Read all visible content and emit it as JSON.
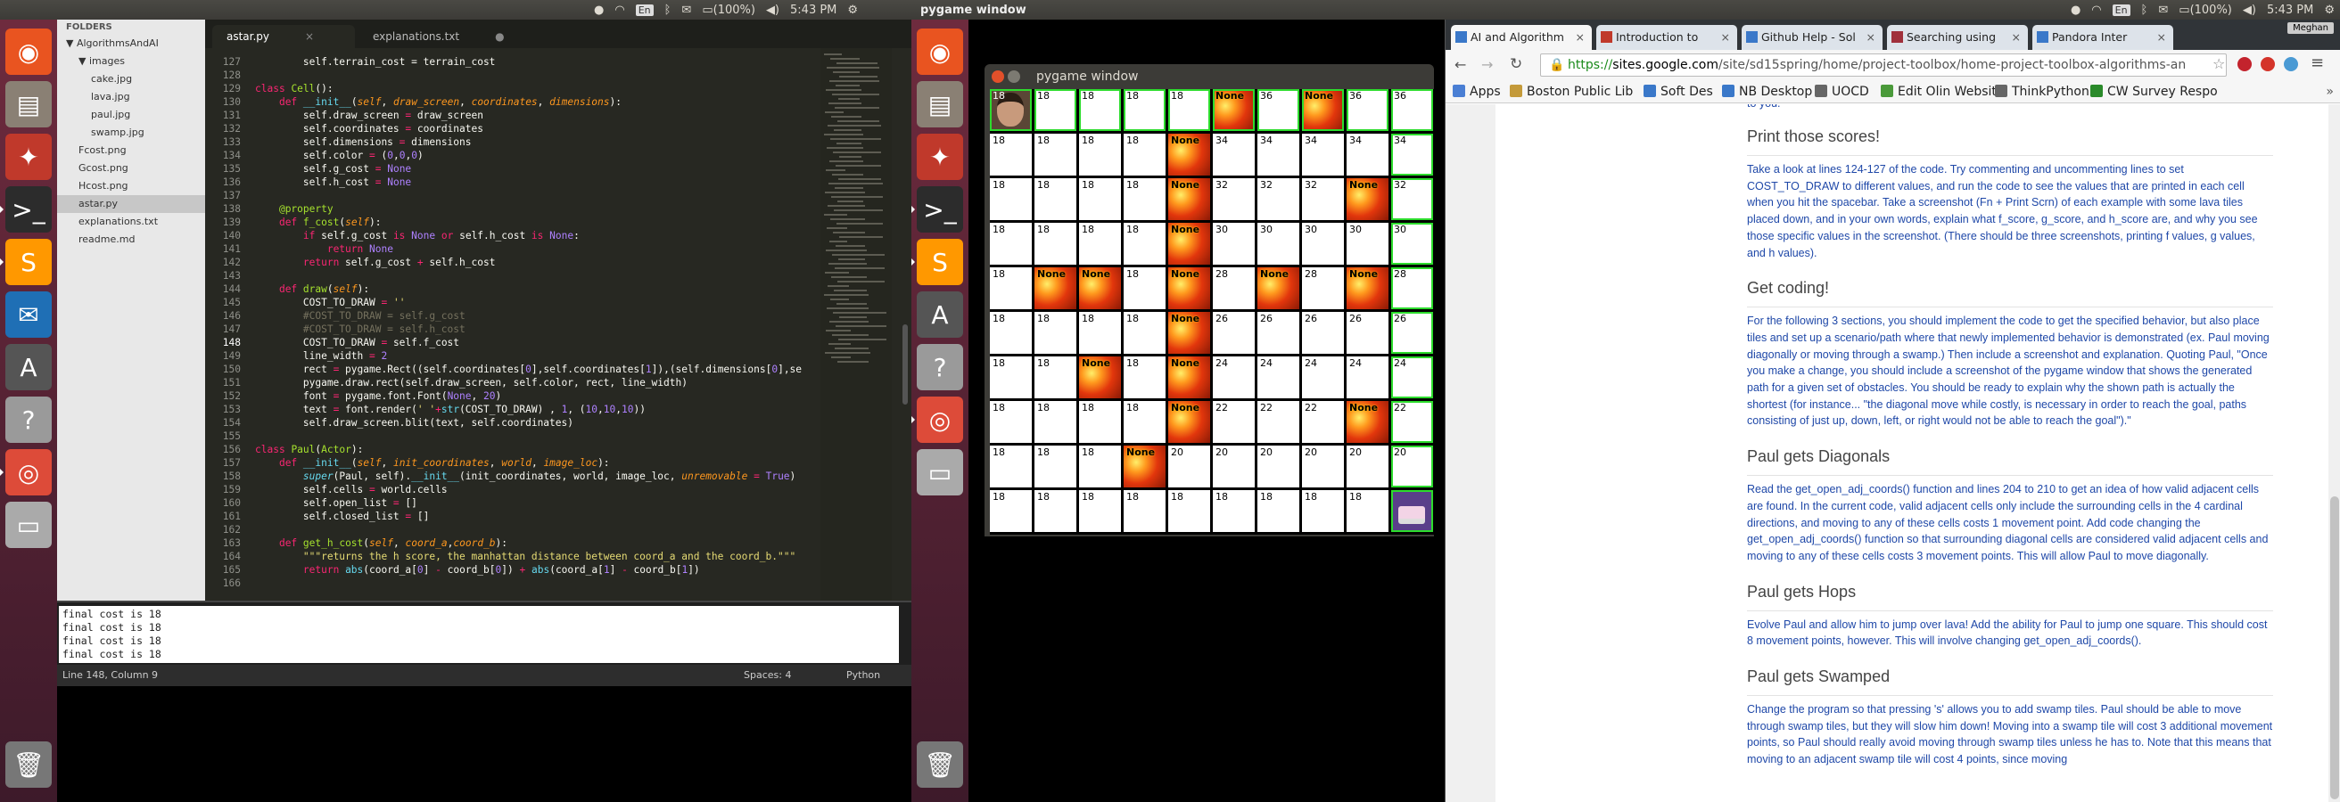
{
  "topbar_left": {
    "lang": "En",
    "battery": "(100%)",
    "time": "5:43 PM",
    "window_title": "pygame window"
  },
  "topbar_right": {
    "lang": "En",
    "battery": "(100%)",
    "time": "5:43 PM"
  },
  "chrome_user": "Meghan",
  "sidebar": {
    "header": "FOLDERS",
    "items": [
      {
        "label": "AlgorithmsAndAI",
        "indent": 0,
        "arrow": "▼"
      },
      {
        "label": "images",
        "indent": 1,
        "arrow": "▼"
      },
      {
        "label": "cake.jpg",
        "indent": 2,
        "arrow": ""
      },
      {
        "label": "lava.jpg",
        "indent": 2,
        "arrow": ""
      },
      {
        "label": "paul.jpg",
        "indent": 2,
        "arrow": ""
      },
      {
        "label": "swamp.jpg",
        "indent": 2,
        "arrow": ""
      },
      {
        "label": "Fcost.png",
        "indent": 1,
        "arrow": ""
      },
      {
        "label": "Gcost.png",
        "indent": 1,
        "arrow": ""
      },
      {
        "label": "Hcost.png",
        "indent": 1,
        "arrow": ""
      },
      {
        "label": "astar.py",
        "indent": 1,
        "arrow": "",
        "selected": true
      },
      {
        "label": "explanations.txt",
        "indent": 1,
        "arrow": ""
      },
      {
        "label": "readme.md",
        "indent": 1,
        "arrow": ""
      }
    ]
  },
  "editor_tabs": [
    {
      "label": "astar.py",
      "close": "×",
      "active": true
    },
    {
      "label": "explanations.txt",
      "close": "●",
      "active": false
    }
  ],
  "code_lines": [
    {
      "n": "127",
      "html": "        self.terrain_cost = terrain_cost"
    },
    {
      "n": "128",
      "html": ""
    },
    {
      "n": "129",
      "html": "<span class='k'>class</span> <span class='f'>Cell</span>():"
    },
    {
      "n": "130",
      "html": "    <span class='k'>def</span> <span class='bl'>__init__</span>(<span class='p'>self</span>, <span class='p'>draw_screen</span>, <span class='p'>coordinates</span>, <span class='p'>dimensions</span>):"
    },
    {
      "n": "131",
      "html": "        self.draw_screen <span class='k'>=</span> draw_screen"
    },
    {
      "n": "132",
      "html": "        self.coordinates <span class='k'>=</span> coordinates"
    },
    {
      "n": "133",
      "html": "        self.dimensions <span class='k'>=</span> dimensions"
    },
    {
      "n": "134",
      "html": "        self.color <span class='k'>=</span> (<span class='n'>0</span>,<span class='n'>0</span>,<span class='n'>0</span>)"
    },
    {
      "n": "135",
      "html": "        self.g_cost <span class='k'>=</span> <span class='n'>None</span>"
    },
    {
      "n": "136",
      "html": "        self.h_cost <span class='k'>=</span> <span class='n'>None</span>"
    },
    {
      "n": "137",
      "html": ""
    },
    {
      "n": "138",
      "html": "    <span class='f'>@property</span>"
    },
    {
      "n": "139",
      "html": "    <span class='k'>def</span> <span class='f'>f_cost</span>(<span class='p'>self</span>):"
    },
    {
      "n": "140",
      "html": "        <span class='k'>if</span> self.g_cost <span class='k'>is</span> <span class='n'>None</span> <span class='k'>or</span> self.h_cost <span class='k'>is</span> <span class='n'>None</span>:"
    },
    {
      "n": "141",
      "html": "            <span class='k'>return</span> <span class='n'>None</span>"
    },
    {
      "n": "142",
      "html": "        <span class='k'>return</span> self.g_cost <span class='k'>+</span> self.h_cost"
    },
    {
      "n": "143",
      "html": ""
    },
    {
      "n": "144",
      "html": "    <span class='k'>def</span> <span class='f'>draw</span>(<span class='p'>self</span>):"
    },
    {
      "n": "145",
      "html": "        COST_TO_DRAW <span class='k'>=</span> <span class='s'>''</span>"
    },
    {
      "n": "146",
      "html": "        <span class='c'>#COST_TO_DRAW = self.g_cost</span>"
    },
    {
      "n": "147",
      "html": "        <span class='c'>#COST_TO_DRAW = self.h_cost</span>"
    },
    {
      "n": "148",
      "html": "        COST_TO_DRAW <span class='k'>=</span> self.f_cost",
      "cur": true
    },
    {
      "n": "149",
      "html": "        line_width <span class='k'>=</span> <span class='n'>2</span>"
    },
    {
      "n": "150",
      "html": "        rect <span class='k'>=</span> pygame.Rect((self.coordinates[<span class='n'>0</span>],self.coordinates[<span class='n'>1</span>]),(self.dimensions[<span class='n'>0</span>],se"
    },
    {
      "n": "151",
      "html": "        pygame.draw.rect(self.draw_screen, self.color, rect, line_width)"
    },
    {
      "n": "152",
      "html": "        font <span class='k'>=</span> pygame.font.Font(<span class='n'>None</span>, <span class='n'>20</span>)"
    },
    {
      "n": "153",
      "html": "        text <span class='k'>=</span> font.render(<span class='s'>' '</span><span class='k'>+</span><span class='bl'>str</span>(COST_TO_DRAW) , <span class='n'>1</span>, (<span class='n'>10</span>,<span class='n'>10</span>,<span class='n'>10</span>))"
    },
    {
      "n": "154",
      "html": "        self.draw_screen.blit(text, self.coordinates)"
    },
    {
      "n": "155",
      "html": ""
    },
    {
      "n": "156",
      "html": "<span class='k'>class</span> <span class='f'>Paul</span>(<span class='f'>Actor</span>):"
    },
    {
      "n": "157",
      "html": "    <span class='k'>def</span> <span class='bl'>__init__</span>(<span class='p'>self</span>, <span class='p'>init_coordinates</span>, <span class='p'>world</span>, <span class='p'>image_loc</span>):"
    },
    {
      "n": "158",
      "html": "        <span class='b'>super</span>(Paul, self).<span class='bl'>__init__</span>(init_coordinates, world, image_loc, <span class='p'>unremovable</span> <span class='k'>=</span> <span class='n'>True</span>)"
    },
    {
      "n": "159",
      "html": "        self.cells <span class='k'>=</span> world.cells"
    },
    {
      "n": "160",
      "html": "        self.open_list <span class='k'>=</span> []"
    },
    {
      "n": "161",
      "html": "        self.closed_list <span class='k'>=</span> []"
    },
    {
      "n": "162",
      "html": ""
    },
    {
      "n": "163",
      "html": "    <span class='k'>def</span> <span class='f'>get_h_cost</span>(<span class='p'>self</span>, <span class='p'>coord_a</span>,<span class='p'>coord_b</span>):"
    },
    {
      "n": "164",
      "html": "        <span class='s'>\"\"\"returns the h score, the manhattan distance between coord_a and the coord_b.\"\"\"</span>"
    },
    {
      "n": "165",
      "html": "        <span class='k'>return</span> <span class='bl'>abs</span>(coord_a[<span class='n'>0</span>] <span class='k'>-</span> coord_b[<span class='n'>0</span>]) <span class='k'>+</span> <span class='bl'>abs</span>(coord_a[<span class='n'>1</span>] <span class='k'>-</span> coord_b[<span class='n'>1</span>])"
    },
    {
      "n": "166",
      "html": ""
    }
  ],
  "console_lines": [
    "final cost is 18",
    "final cost is 18",
    "final cost is 18",
    "final cost is 18"
  ],
  "status": {
    "position": "Line 148, Column 9",
    "spaces": "Spaces: 4",
    "syntax": "Python"
  },
  "pygame": {
    "title": "pygame window",
    "lava_label": "None",
    "rows": [
      [
        "P18",
        "18",
        "18",
        "18",
        "18",
        "L",
        "36",
        "L",
        "36",
        "36"
      ],
      [
        "18",
        "18",
        "18",
        "18",
        "L",
        "34",
        "34",
        "34",
        "34",
        "34"
      ],
      [
        "18",
        "18",
        "18",
        "18",
        "L",
        "32",
        "32",
        "32",
        "L",
        "32"
      ],
      [
        "18",
        "18",
        "18",
        "18",
        "L",
        "30",
        "30",
        "30",
        "30",
        "30"
      ],
      [
        "18",
        "L",
        "L",
        "18",
        "L",
        "28",
        "L",
        "28",
        "L",
        "28"
      ],
      [
        "18",
        "18",
        "18",
        "18",
        "L",
        "26",
        "26",
        "26",
        "26",
        "26"
      ],
      [
        "18",
        "18",
        "L",
        "18",
        "L",
        "24",
        "24",
        "24",
        "24",
        "24"
      ],
      [
        "18",
        "18",
        "18",
        "18",
        "L",
        "22",
        "22",
        "22",
        "L",
        "22"
      ],
      [
        "18",
        "18",
        "18",
        "L",
        "20",
        "20",
        "20",
        "20",
        "20",
        "20"
      ],
      [
        "18",
        "18",
        "18",
        "18",
        "18",
        "18",
        "18",
        "18",
        "18",
        "C"
      ]
    ],
    "green": [
      [
        0,
        0
      ],
      [
        1,
        0
      ],
      [
        2,
        0
      ],
      [
        3,
        0
      ],
      [
        4,
        0
      ],
      [
        5,
        0
      ],
      [
        6,
        0
      ],
      [
        7,
        0
      ],
      [
        8,
        0
      ],
      [
        9,
        0
      ],
      [
        9,
        1
      ],
      [
        9,
        2
      ],
      [
        9,
        3
      ],
      [
        9,
        4
      ],
      [
        9,
        5
      ],
      [
        9,
        6
      ],
      [
        9,
        7
      ],
      [
        9,
        8
      ],
      [
        9,
        9
      ]
    ]
  },
  "chrome": {
    "tabs": [
      {
        "label": "AI and Algorithm",
        "color": "#3a78c9"
      },
      {
        "label": "Introduction to",
        "color": "#c0392b"
      },
      {
        "label": "Github Help - Sol",
        "color": "#3a78c9"
      },
      {
        "label": "Searching using",
        "color": "#a0303b"
      },
      {
        "label": "Pandora Inter",
        "color": "#3a78c9"
      }
    ],
    "url_scheme": "https://",
    "url_host": "sites.google.com",
    "url_path": "/site/sd15spring/home/project-toolbox/home-project-toolbox-algorithms-an",
    "bookmarks": [
      {
        "label": "Apps",
        "color": "#4a7fd4"
      },
      {
        "label": "Boston Public Lib",
        "color": "#c49a3a"
      },
      {
        "label": "Soft Des",
        "color": "#3a78c9"
      },
      {
        "label": "NB Desktop",
        "color": "#3a78c9"
      },
      {
        "label": "UOCD",
        "color": "#666"
      },
      {
        "label": "Edit Olin Website",
        "color": "#4a9a3a"
      },
      {
        "label": "ThinkPython",
        "color": "#666"
      },
      {
        "label": "CW Survey Respo",
        "color": "#2a8a2a"
      }
    ],
    "more": "»"
  },
  "doc": {
    "pre": "to you.",
    "sections": [
      {
        "h": "Print those scores!",
        "p": "Take a look at lines 124-127 of the code. Try commenting and uncommenting lines to set COST_TO_DRAW to different values, and run the code to see the values that are printed in each cell when you hit the spacebar. Take a screenshot (Fn + Print Scrn) of each example with some lava tiles placed down, and in your own words, explain what f_score, g_score, and h_score are, and why you see those specific values in the screenshot. (There should be three screenshots, printing f values, g values, and h values)."
      },
      {
        "h": "Get coding!",
        "p": "For the following 3 sections, you should implement the code to get the specified behavior, but also place tiles and set up a scenario/path where that newly implemented behavior is demonstrated (ex. Paul moving diagonally or moving through a swamp.) Then include a screenshot and explanation. Quoting Paul, \"Once you make a change, you should include a screenshot of the pygame window that shows the generated path for a given set of obstacles. You should be ready to explain why the shown path is actually the shortest (for instance... \"the diagonal move while costly, is necessary in order to reach the goal, paths consisting of just up, down, left, or right would not be able to reach the goal\").\""
      },
      {
        "h": "Paul gets Diagonals",
        "p": "Read the get_open_adj_coords() function and lines 204 to 210 to get an idea of how valid adjacent cells are found. In the current code, valid adjacent cells only include the surrounding cells in the 4 cardinal directions, and moving to any of these cells costs 1 movement point. Add code changing the get_open_adj_coords() function so that surrounding diagonal cells are considered valid adjacent cells and moving to any of these cells costs 3 movement points. This will allow Paul to move diagonally."
      },
      {
        "h": "Paul gets Hops",
        "p": "Evolve Paul and allow him to jump over lava! Add the ability for Paul to jump one square. This should cost 8 movement points, however. This will involve changing get_open_adj_coords()."
      },
      {
        "h": "Paul gets Swamped",
        "p": "Change the program so that pressing 's' allows you to add swamp tiles. Paul should be able to move through swamp tiles, but they will slow him down! Moving into a swamp tile will cost 3 additional movement points, so Paul should really avoid moving through swamp tiles unless he has to. Note that this means that moving to an adjacent swamp tile will cost 4 points, since moving"
      }
    ]
  }
}
